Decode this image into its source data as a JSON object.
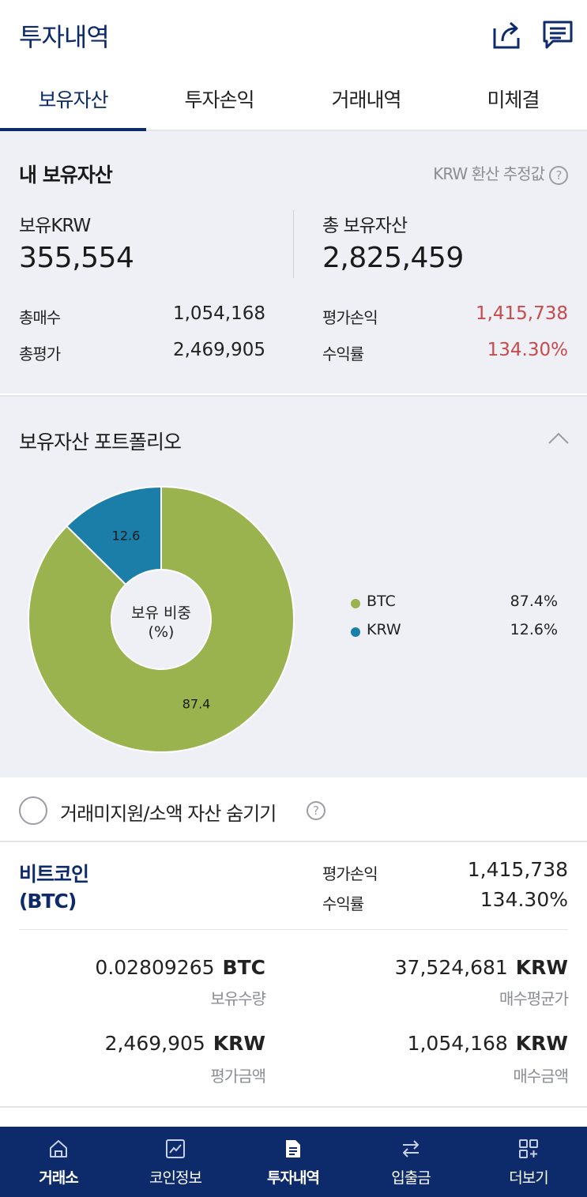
{
  "header": {
    "title": "투자내역",
    "share_icon": "share-icon",
    "message_icon": "message-icon"
  },
  "tabs": [
    {
      "label": "보유자산",
      "active": true
    },
    {
      "label": "투자손익",
      "active": false
    },
    {
      "label": "거래내역",
      "active": false
    },
    {
      "label": "미체결",
      "active": false
    }
  ],
  "summary": {
    "title": "내 보유자산",
    "note": "KRW 환산 추정값",
    "krw_label": "보유KRW",
    "krw_value": "355,554",
    "total_label": "총 보유자산",
    "total_value": "2,825,459",
    "buy_total_label": "총매수",
    "buy_total_value": "1,054,168",
    "eval_total_label": "총평가",
    "eval_total_value": "2,469,905",
    "pnl_label": "평가손익",
    "pnl_value": "1,415,738",
    "rate_label": "수익률",
    "rate_value": "134.30%",
    "positive_color": "#c94a4a"
  },
  "portfolio": {
    "title": "보유자산 포트폴리오",
    "collapse_icon": "chevron-up-icon",
    "center_label_line1": "보유 비중",
    "center_label_line2": "(%)",
    "chart_data": {
      "type": "pie",
      "categories": [
        "BTC",
        "KRW"
      ],
      "values": [
        87.4,
        12.6
      ],
      "slice_labels": [
        "87.4",
        "12.6"
      ],
      "legend_values": [
        "87.4%",
        "12.6%"
      ],
      "colors": [
        "#9ab34f",
        "#1a7ea8"
      ],
      "legend": "right"
    }
  },
  "hide_option": {
    "label": "거래미지원/소액 자산 숨기기",
    "checked": false
  },
  "coin": {
    "name_line1": "비트코인",
    "name_line2": "(BTC)",
    "pnl_label": "평가손익",
    "pnl_value": "1,415,738",
    "rate_label": "수익률",
    "rate_value": "134.30%",
    "holding_amount": "0.02809265",
    "holding_unit": "BTC",
    "holding_label": "보유수량",
    "avg_price": "37,524,681",
    "avg_unit": "KRW",
    "avg_label": "매수평균가",
    "eval_amount": "2,469,905",
    "eval_unit": "KRW",
    "eval_label": "평가금액",
    "buy_amount": "1,054,168",
    "buy_unit": "KRW",
    "buy_label": "매수금액"
  },
  "bottom_nav": [
    {
      "label": "거래소",
      "icon": "home-icon",
      "bold": true
    },
    {
      "label": "코인정보",
      "icon": "chart-icon",
      "bold": false
    },
    {
      "label": "투자내역",
      "icon": "document-icon",
      "bold": true
    },
    {
      "label": "입출금",
      "icon": "transfer-icon",
      "bold": false
    },
    {
      "label": "더보기",
      "icon": "grid-plus-icon",
      "bold": false
    }
  ],
  "colors": {
    "brand": "#0d2a6b",
    "panel_bg": "#eef0f5",
    "btc": "#9ab34f",
    "krw": "#1a7ea8"
  }
}
